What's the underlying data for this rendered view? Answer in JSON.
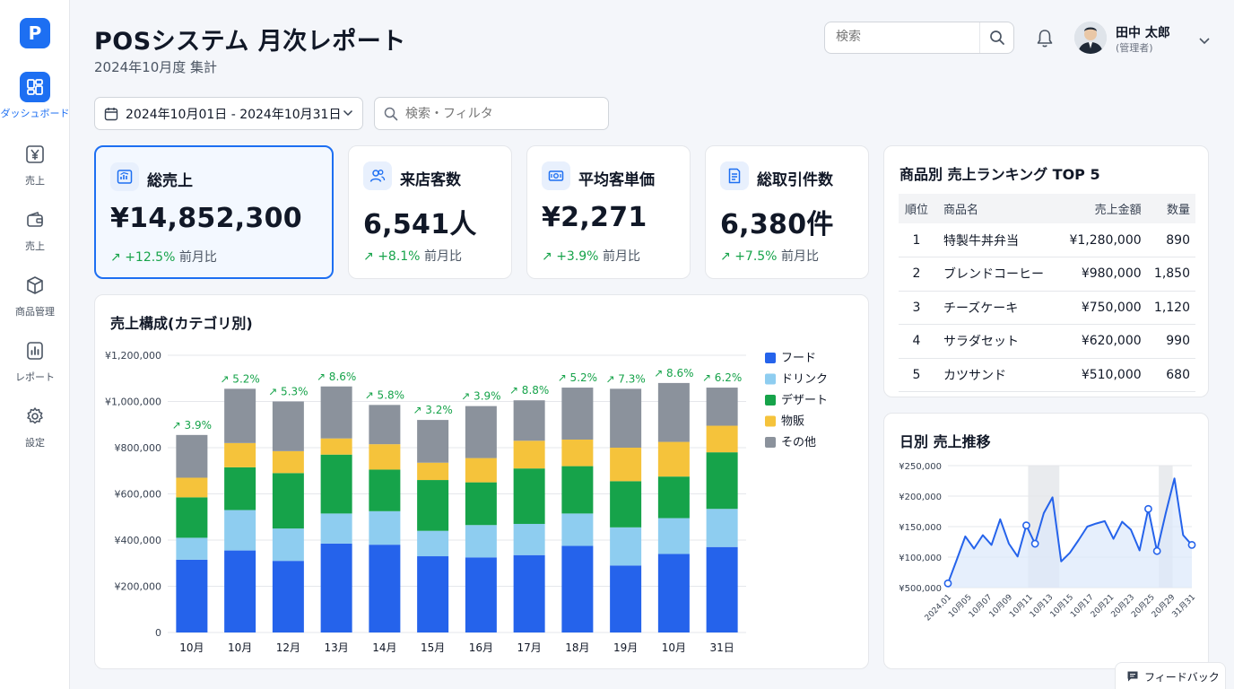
{
  "app": {
    "logo_letter": "P"
  },
  "sidebar": {
    "items": [
      {
        "label": "ダッシュボード",
        "icon": "dashboard-icon",
        "active": true
      },
      {
        "label": "売上",
        "icon": "yen-icon"
      },
      {
        "label": "売上",
        "icon": "wallet-icon"
      },
      {
        "label": "商品管理",
        "icon": "box-icon"
      },
      {
        "label": "レポート",
        "icon": "report-chart-icon"
      },
      {
        "label": "設定",
        "icon": "gear-icon"
      }
    ]
  },
  "header": {
    "title": "POSシステム 月次レポート",
    "subtitle": "2024年10月度 集計",
    "search_placeholder": "検索",
    "user": {
      "name": "田中 太郎",
      "role": "(管理者)"
    }
  },
  "filters": {
    "date_range": "2024年10月01日 - 2024年10月31日",
    "search_placeholder": "検索・フィルタ"
  },
  "kpis": [
    {
      "label": "総売上",
      "value": "¥14,852,300",
      "change": "+12.5%",
      "change_suffix": "前月比",
      "icon": "sales-chart-icon"
    },
    {
      "label": "来店客数",
      "value": "6,541人",
      "change": "+8.1%",
      "change_suffix": "前月比",
      "icon": "users-icon"
    },
    {
      "label": "平均客単価",
      "value": "¥2,271",
      "change": "+3.9%",
      "change_suffix": "前月比",
      "icon": "money-icon"
    },
    {
      "label": "総取引件数",
      "value": "6,380件",
      "change": "+7.5%",
      "change_suffix": "前月比",
      "icon": "receipt-icon"
    }
  ],
  "ranking": {
    "title": "商品別 売上ランキング TOP 5",
    "columns": [
      "順位",
      "商品名",
      "売上金額",
      "数量"
    ],
    "rows": [
      [
        "1",
        "特製牛丼弁当",
        "¥1,280,000",
        "890"
      ],
      [
        "2",
        "ブレンドコーヒー",
        "¥980,000",
        "1,850"
      ],
      [
        "3",
        "チーズケーキ",
        "¥750,000",
        "1,120"
      ],
      [
        "4",
        "サラダセット",
        "¥620,000",
        "990"
      ],
      [
        "5",
        "カツサンド",
        "¥510,000",
        "680"
      ]
    ]
  },
  "feedback_label": "フィードバック",
  "colors": {
    "accent": "#1d6ff2",
    "up": "#16a34a",
    "food": "#2563eb",
    "drink": "#8ecdf0",
    "dessert": "#16a34a",
    "goods": "#f5c33b",
    "other": "#8b929c"
  },
  "chart_data": [
    {
      "type": "bar",
      "stacked": true,
      "title": "売上構成(カテゴリ別)",
      "categories": [
        "10月",
        "10月",
        "12月",
        "13月",
        "14月",
        "15月",
        "16月",
        "17月",
        "18月",
        "19月",
        "10月",
        "31日"
      ],
      "series": [
        {
          "name": "フード",
          "color": "#2563eb",
          "values": [
            315000,
            355000,
            310000,
            385000,
            380000,
            330000,
            325000,
            335000,
            375000,
            290000,
            340000,
            370000
          ]
        },
        {
          "name": "ドリンク",
          "color": "#8ecdf0",
          "values": [
            95000,
            175000,
            140000,
            130000,
            145000,
            110000,
            140000,
            135000,
            140000,
            165000,
            155000,
            165000
          ]
        },
        {
          "name": "デザート",
          "color": "#16a34a",
          "values": [
            175000,
            185000,
            240000,
            255000,
            180000,
            220000,
            185000,
            240000,
            205000,
            200000,
            180000,
            245000
          ]
        },
        {
          "name": "物販",
          "color": "#f5c33b",
          "values": [
            85000,
            105000,
            95000,
            70000,
            110000,
            75000,
            105000,
            120000,
            115000,
            145000,
            150000,
            115000
          ]
        },
        {
          "name": "その他",
          "color": "#8b929c",
          "values": [
            185000,
            235000,
            215000,
            225000,
            170000,
            185000,
            225000,
            175000,
            225000,
            255000,
            255000,
            165000
          ]
        }
      ],
      "annotations": [
        "3.9%",
        "5.2%",
        "5.3%",
        "8.6%",
        "5.8%",
        "3.2%",
        "3.9%",
        "8.8%",
        "5.2%",
        "7.3%",
        "8.6%",
        "6.2%"
      ],
      "ylim": [
        0,
        1200000
      ],
      "yticks": [
        "0",
        "¥200,000",
        "¥400,000",
        "¥600,000",
        "¥800,000",
        "¥1,000,000",
        "¥1,200,000"
      ],
      "legend": "right",
      "grid": true
    },
    {
      "type": "line",
      "title": "日別 売上推移",
      "x": [
        "2024.01",
        "10月05",
        "10月07",
        "10月09",
        "10月11",
        "10月13",
        "10月15",
        "20月17",
        "20月21",
        "20月23",
        "20月25",
        "20月29",
        "31月31"
      ],
      "xlabels": [
        "2024.01",
        "10月05",
        "10月07",
        "10月09",
        "10月11",
        "10月13",
        "10月15",
        "10月17",
        "20月21",
        "20月23",
        "20月25",
        "20月29",
        "31月31"
      ],
      "values": [
        57000,
        95000,
        134000,
        114000,
        136000,
        120000,
        162000,
        122000,
        101000,
        152000,
        122000,
        172000,
        198000,
        93000,
        107000,
        128000,
        150000,
        155000,
        159000,
        130000,
        158000,
        145000,
        111000,
        179000,
        110000,
        172000,
        229000,
        136000,
        120000
      ],
      "markers": [
        0,
        9,
        10,
        23,
        24,
        28
      ],
      "highlight_ranges": [
        [
          9,
          13
        ],
        [
          24,
          26
        ]
      ],
      "ylim": [
        50000,
        250000
      ],
      "yticks": [
        "¥500,000",
        "¥100,000",
        "¥150,000",
        "¥200,000",
        "¥250,000"
      ],
      "grid": true
    }
  ]
}
